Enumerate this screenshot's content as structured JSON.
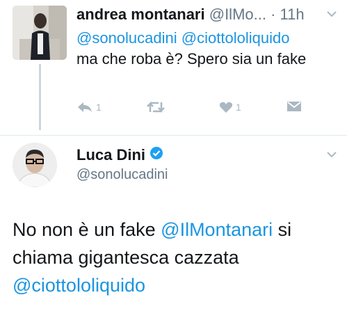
{
  "reply": {
    "author_name": "andrea montanari",
    "author_handle": "@IlMo...",
    "time": "· 11h",
    "mentions": [
      "@sonolucadini",
      "@ciottololiquido"
    ],
    "text": "ma che roba è?  Spero sia un fake",
    "actions": {
      "reply_count": "1",
      "retweet_count": "",
      "like_count": "1"
    }
  },
  "tweet": {
    "author_name": "Luca Dini",
    "author_handle": "@sonolucadini",
    "text_parts": {
      "p1": "No non è un fake ",
      "mention1": "@IlMontanari",
      "p2": " si chiama gigantesca cazzata ",
      "mention2": "@ciottololiquido"
    }
  },
  "icons": [
    "chevron-down-icon",
    "reply-icon",
    "retweet-icon",
    "like-icon",
    "message-icon",
    "verified-badge-icon"
  ],
  "colors": {
    "link": "#1b95e0",
    "muted": "#657786",
    "icon": "#aab8c2",
    "verified": "#1da1f2"
  }
}
